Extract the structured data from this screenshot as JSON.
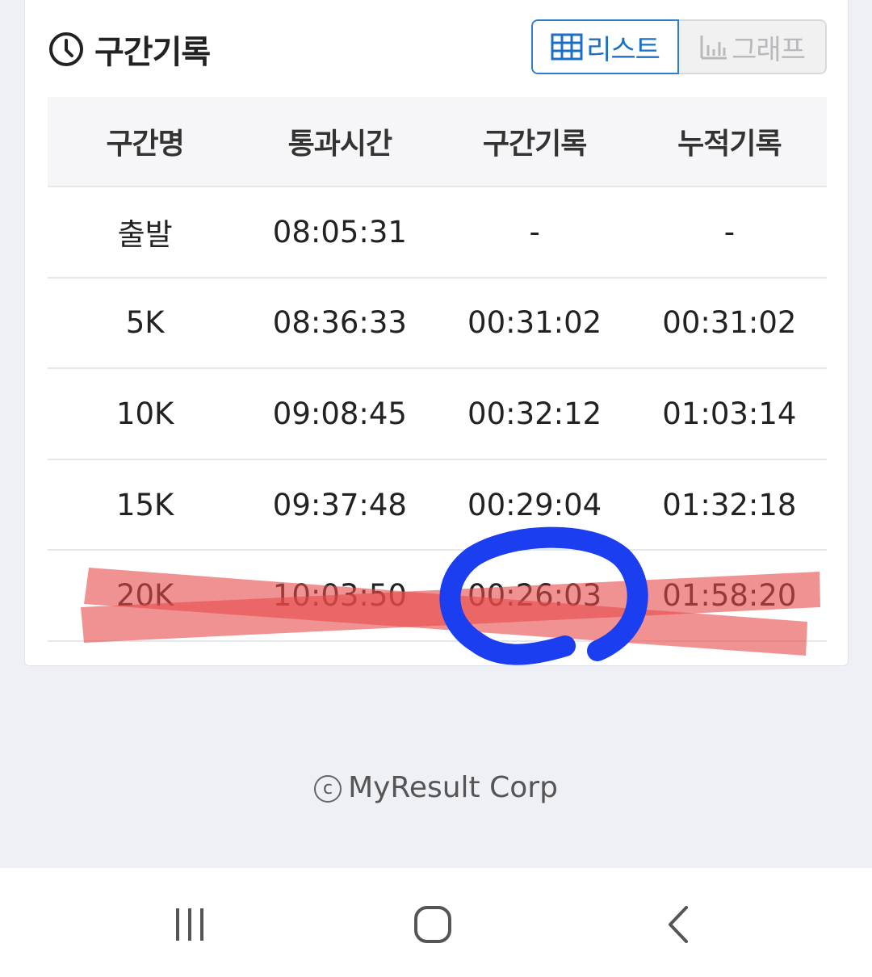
{
  "section": {
    "title": "구간기록",
    "icon": "clock-icon"
  },
  "view_toggle": {
    "list_label": "리스트",
    "graph_label": "그래프",
    "selected": "list",
    "accent_color": "#2a7fd1"
  },
  "table": {
    "headers": [
      "구간명",
      "통과시간",
      "구간기록",
      "누적기록"
    ],
    "rows": [
      [
        "출발",
        "08:05:31",
        "-",
        "-"
      ],
      [
        "5K",
        "08:36:33",
        "00:31:02",
        "00:31:02"
      ],
      [
        "10K",
        "09:08:45",
        "00:32:12",
        "01:03:14"
      ],
      [
        "15K",
        "09:37:48",
        "00:29:04",
        "01:32:18"
      ],
      [
        "20K",
        "10:03:50",
        "00:26:03",
        "01:58:20"
      ]
    ]
  },
  "annotations": {
    "strike_color": "#e84a4a",
    "circle_color": "#1a3ef0"
  },
  "footer": {
    "copyright_symbol": "c",
    "text": "MyResult Corp"
  },
  "navbar": {
    "recent_icon": "recent-apps-icon",
    "home_icon": "home-icon",
    "back_icon": "back-icon"
  }
}
